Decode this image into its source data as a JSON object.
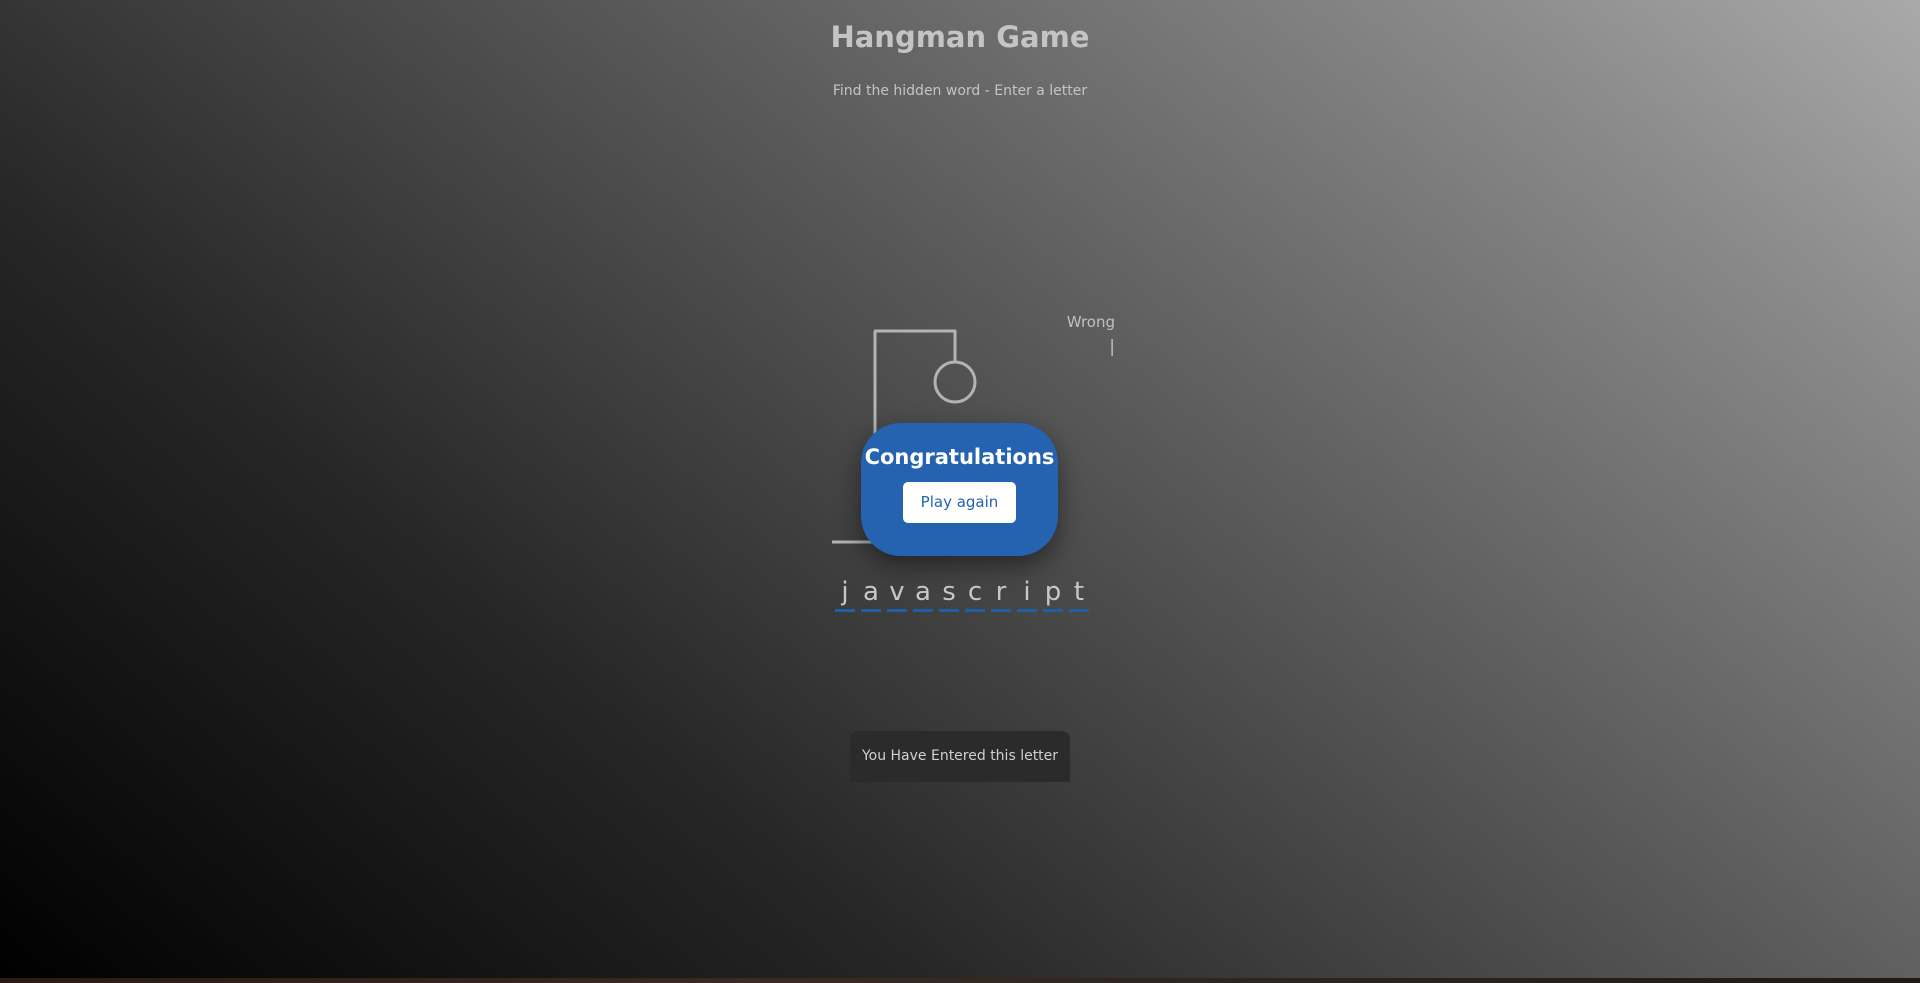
{
  "header": {
    "title": "Hangman Game",
    "subtitle": "Find the hidden word - Enter a letter"
  },
  "wrong_letters": {
    "label": "Wrong",
    "letters": "|"
  },
  "word": {
    "letters": [
      "j",
      "a",
      "v",
      "a",
      "s",
      "c",
      "r",
      "i",
      "p",
      "t"
    ]
  },
  "popup": {
    "title": "Congratulations",
    "button_label": "Play again",
    "color": "#2563b0"
  },
  "notification": {
    "text": "You Have Entered this letter"
  }
}
